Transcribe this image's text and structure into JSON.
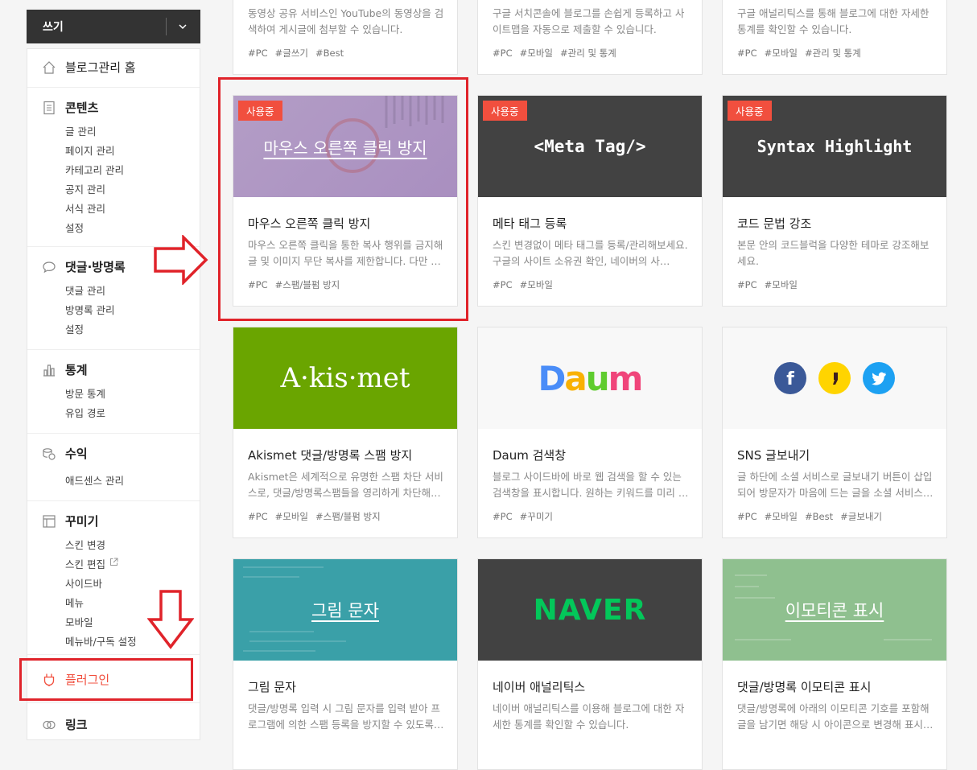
{
  "write": {
    "label": "쓰기"
  },
  "sidebar": {
    "home": "블로그관리 홈",
    "contents": {
      "title": "콘텐츠",
      "items": [
        "글 관리",
        "페이지 관리",
        "카테고리 관리",
        "공지 관리",
        "서식 관리",
        "설정"
      ]
    },
    "comments": {
      "title": "댓글·방명록",
      "items": [
        "댓글 관리",
        "방명록 관리",
        "설정"
      ]
    },
    "stats": {
      "title": "통계",
      "items": [
        "방문 통계",
        "유입 경로"
      ]
    },
    "revenue": {
      "title": "수익",
      "items": [
        "애드센스 관리"
      ]
    },
    "decorate": {
      "title": "꾸미기",
      "items": [
        "스킨 변경",
        "스킨 편집",
        "사이드바",
        "메뉴",
        "모바일",
        "메뉴바/구독 설정"
      ]
    },
    "plugin": "플러그인",
    "link": "링크"
  },
  "badge_label": "사용중",
  "cards": [
    {
      "desc": "동영상 공유 서비스인 YouTube의 동영상을 검색하여 게시글에 첨부할 수 있습니다.",
      "tags": [
        "#PC",
        "#글쓰기",
        "#Best"
      ]
    },
    {
      "desc": "구글 서치콘솔에 블로그를 손쉽게 등록하고 사이트맵을 자동으로 제출할 수 있습니다.",
      "tags": [
        "#PC",
        "#모바일",
        "#관리 및 통계"
      ]
    },
    {
      "desc": "구글 애널리틱스를 통해 블로그에 대한 자세한 통계를 확인할 수 있습니다.",
      "tags": [
        "#PC",
        "#모바일",
        "#관리 및 통계"
      ]
    },
    {
      "thumb": "마우스 오른쪽 클릭 방지",
      "title": "마우스 오른쪽 클릭 방지",
      "desc": "마우스 오른쪽 클릭을 통한 복사 행위를 금지해 글 및 이미지 무단 복사를 제한합니다. 다만 …",
      "tags": [
        "#PC",
        "#스팸/블펌 방지"
      ]
    },
    {
      "thumb": "<Meta Tag/>",
      "title": "메타 태그 등록",
      "desc": "스킨 변경없이 메타 태그를 등록/관리해보세요. 구글의 사이트 소유권 확인, 네이버의 사…",
      "tags": [
        "#PC",
        "#모바일"
      ]
    },
    {
      "thumb": "Syntax Highlight",
      "title": "코드 문법 강조",
      "desc": "본문 안의 코드블럭을 다양한 테마로 강조해보세요.",
      "tags": [
        "#PC",
        "#모바일"
      ]
    },
    {
      "thumb": "A·kis·met",
      "title": "Akismet 댓글/방명록 스팸 방지",
      "desc": "Akismet은 세계적으로 유명한 스팸 차단 서비스로, 댓글/방명록스팸들을 영리하게 차단해…",
      "tags": [
        "#PC",
        "#모바일",
        "#스팸/블펌 방지"
      ]
    },
    {
      "thumb": "Daum",
      "title": "Daum 검색창",
      "desc": "블로그 사이드바에 바로 웹 검색을 할 수 있는 검색창을 표시합니다. 원하는 키워드를 미리 …",
      "tags": [
        "#PC",
        "#꾸미기"
      ]
    },
    {
      "title": "SNS 글보내기",
      "desc": "글 하단에 소셜 서비스로 글보내기 버튼이 삽입되어 방문자가 마음에 드는 글을 소셜 서비스…",
      "tags": [
        "#PC",
        "#모바일",
        "#Best",
        "#글보내기"
      ]
    },
    {
      "thumb": "그림 문자",
      "title": "그림 문자",
      "desc": "댓글/방명록 입력 시 그림 문자를 입력 받아 프로그램에 의한 스팸 등록을 방지할 수 있도록…"
    },
    {
      "thumb": "NAVER",
      "title": "네이버 애널리틱스",
      "desc": "네이버 애널리틱스를 이용해 블로그에 대한 자세한 통계를 확인할 수 있습니다."
    },
    {
      "thumb": "이모티콘 표시",
      "title": "댓글/방명록 이모티콘 표시",
      "desc": "댓글/방명록에 아래의 이모티콘 기호를 포함해 글을 남기면 해당 시 아이콘으로 변경해 표시…"
    }
  ],
  "colors": {
    "accent": "#f14f3e",
    "annotation": "#e0232a",
    "akismet": "#6aa500",
    "naver": "#03c75a"
  }
}
